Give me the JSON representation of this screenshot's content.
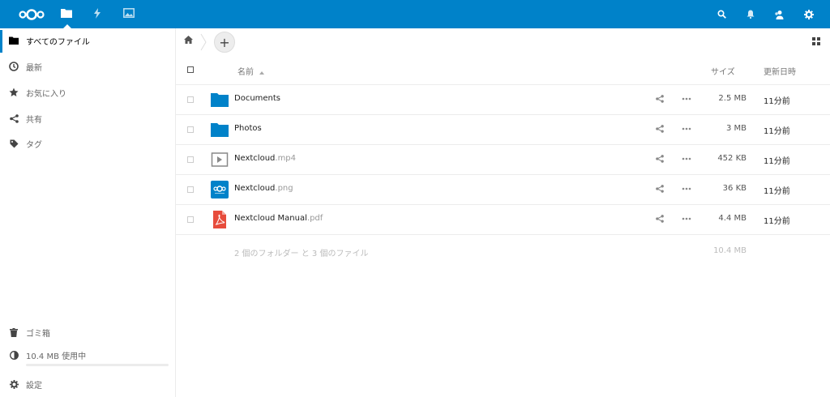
{
  "colors": {
    "brand": "#0082c9",
    "folder": "#0082c9",
    "pdf": "#e74c3c"
  },
  "header": {
    "apps": [
      {
        "name": "files",
        "icon": "folder-icon",
        "active": true
      },
      {
        "name": "activity",
        "icon": "lightning-icon",
        "active": false
      },
      {
        "name": "gallery",
        "icon": "image-icon",
        "active": false
      }
    ],
    "right_icons": [
      "search-icon",
      "bell-icon",
      "contacts-icon",
      "gear-icon"
    ]
  },
  "sidebar": {
    "items": [
      {
        "label": "すべてのファイル",
        "icon": "folder-icon",
        "active": true
      },
      {
        "label": "最新",
        "icon": "clock-icon",
        "active": false
      },
      {
        "label": "お気に入り",
        "icon": "star-icon",
        "active": false
      },
      {
        "label": "共有",
        "icon": "share-icon",
        "active": false
      },
      {
        "label": "タグ",
        "icon": "tag-icon",
        "active": false
      }
    ],
    "trash": {
      "label": "ゴミ箱",
      "icon": "trash-icon"
    },
    "quota": {
      "label": "10.4 MB 使用中",
      "icon": "pie-icon",
      "used_fraction": 0.0
    },
    "settings": {
      "label": "設定",
      "icon": "gear-icon"
    }
  },
  "controls": {
    "add_label": "+"
  },
  "table": {
    "headers": {
      "name": "名前",
      "size": "サイズ",
      "modified": "更新日時"
    },
    "rows": [
      {
        "name": "Documents",
        "ext": "",
        "type": "folder",
        "size": "2.5 MB",
        "modified": "11分前"
      },
      {
        "name": "Photos",
        "ext": "",
        "type": "folder",
        "size": "3 MB",
        "modified": "11分前"
      },
      {
        "name": "Nextcloud",
        "ext": ".mp4",
        "type": "video",
        "size": "452 KB",
        "modified": "11分前"
      },
      {
        "name": "Nextcloud",
        "ext": ".png",
        "type": "image",
        "size": "36 KB",
        "modified": "11分前"
      },
      {
        "name": "Nextcloud Manual",
        "ext": ".pdf",
        "type": "pdf",
        "size": "4.4 MB",
        "modified": "11分前"
      }
    ],
    "summary": {
      "text": "2 個のフォルダー と 3 個のファイル",
      "size": "10.4 MB"
    }
  }
}
